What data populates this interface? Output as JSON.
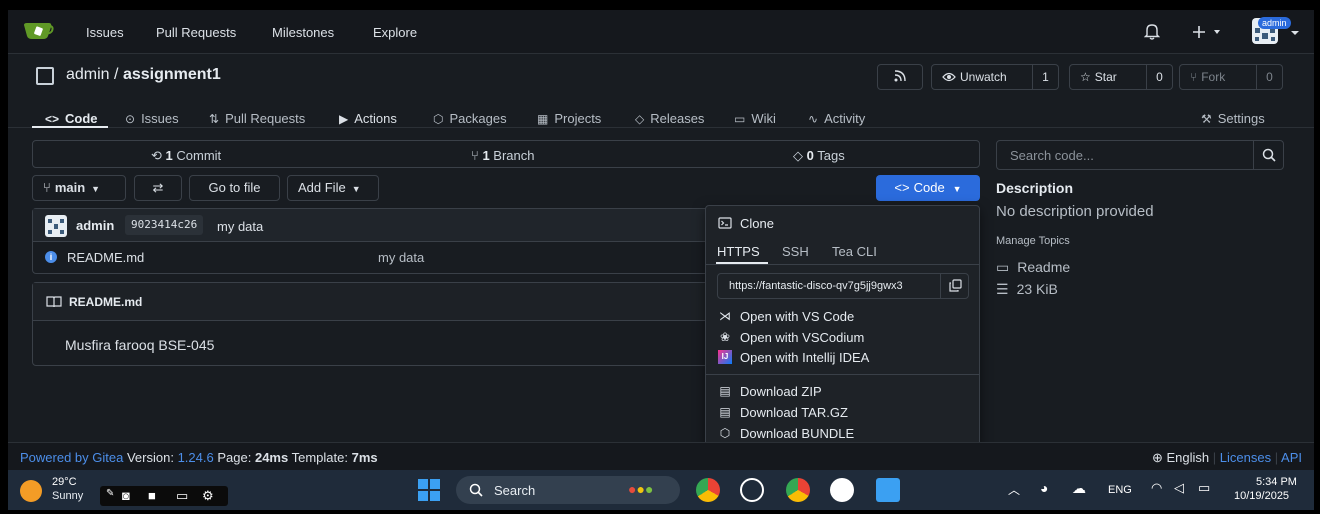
{
  "topnav": {
    "links": [
      "Issues",
      "Pull Requests",
      "Milestones",
      "Explore"
    ],
    "avatar_badge": "admin"
  },
  "repo": {
    "owner": "admin",
    "separator": "/",
    "name": "assignment1",
    "unwatch_label": "Unwatch",
    "watch_count": "1",
    "star_label": "Star",
    "star_count": "0",
    "fork_label": "Fork",
    "fork_count": "0"
  },
  "tabs": [
    "Code",
    "Issues",
    "Pull Requests",
    "Actions",
    "Packages",
    "Projects",
    "Releases",
    "Wiki",
    "Activity"
  ],
  "settings_label": "Settings",
  "stats": {
    "commits_num": "1",
    "commits_label": "Commit",
    "branches_num": "1",
    "branches_label": "Branch",
    "tags_num": "0",
    "tags_label": "Tags"
  },
  "toolbar": {
    "branch": "main",
    "go_to_file": "Go to file",
    "add_file": "Add File",
    "code": "Code"
  },
  "latest_commit": {
    "author": "admin",
    "sha": "9023414c26",
    "message": "my data"
  },
  "files": [
    {
      "name": "README.md",
      "message": "my data"
    }
  ],
  "readme": {
    "title": "README.md",
    "content": "Musfira farooq BSE-045"
  },
  "sidebar": {
    "search_placeholder": "Search code...",
    "description_title": "Description",
    "description_text": "No description provided",
    "manage_topics": "Manage Topics",
    "readme_label": "Readme",
    "size_label": "23  KiB"
  },
  "clone_menu": {
    "title": "Clone",
    "tabs": [
      "HTTPS",
      "SSH",
      "Tea CLI"
    ],
    "url": "https://fantastic-disco-qv7g5jj9gwx3",
    "open_items": [
      "Open with VS Code",
      "Open with VSCodium",
      "Open with Intellij IDEA"
    ],
    "download_items": [
      "Download ZIP",
      "Download TAR.GZ",
      "Download BUNDLE"
    ]
  },
  "footer": {
    "powered_by": "Powered by Gitea",
    "version_label": "Version:",
    "version": "1.24.6",
    "page_label": "Page:",
    "page_time": "24ms",
    "template_label": "Template:",
    "template_time": "7ms",
    "language": "English",
    "licenses": "Licenses",
    "api": "API"
  },
  "taskbar": {
    "temperature": "29°C",
    "condition": "Sunny",
    "search_label": "Search",
    "language": "ENG",
    "time": "5:34 PM",
    "date": "10/19/2025"
  },
  "colors": {
    "accent": "#2b6bdc",
    "link": "#4c8ee9",
    "background": "#181c21"
  }
}
